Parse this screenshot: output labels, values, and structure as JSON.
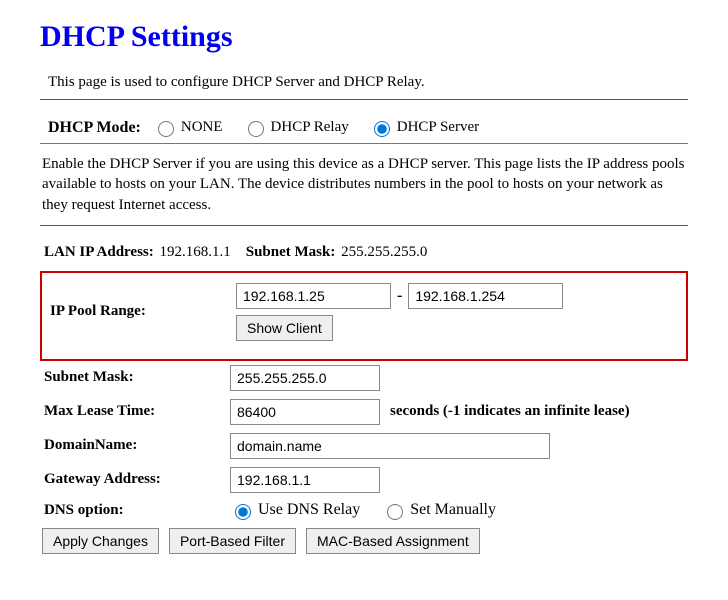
{
  "title": "DHCP Settings",
  "intro": "This page is used to configure DHCP Server and DHCP Relay.",
  "mode": {
    "label": "DHCP Mode:",
    "options": {
      "none": "NONE",
      "relay": "DHCP Relay",
      "server": "DHCP Server"
    },
    "selected": "server"
  },
  "description": "Enable the DHCP Server if you are using this device as a DHCP server. This page lists the IP address pools available to hosts on your LAN. The device distributes numbers in the pool to hosts on your network as they request Internet access.",
  "lan": {
    "ip_label": "LAN IP Address:",
    "ip_value": "192.168.1.1",
    "mask_label": "Subnet Mask:",
    "mask_value": "255.255.255.0"
  },
  "pool": {
    "label": "IP Pool Range:",
    "start": "192.168.1.25",
    "end": "192.168.1.254",
    "show_client": "Show Client"
  },
  "subnet": {
    "label": "Subnet Mask:",
    "value": "255.255.255.0"
  },
  "lease": {
    "label": "Max Lease Time:",
    "value": "86400",
    "suffix": "seconds (-1 indicates an infinite lease)"
  },
  "domain": {
    "label": "DomainName:",
    "value": "domain.name"
  },
  "gateway": {
    "label": "Gateway Address:",
    "value": "192.168.1.1"
  },
  "dns": {
    "label": "DNS option:",
    "relay": "Use DNS Relay",
    "manual": "Set Manually",
    "selected": "relay"
  },
  "buttons": {
    "apply": "Apply Changes",
    "port_filter": "Port-Based Filter",
    "mac_assign": "MAC-Based Assignment"
  }
}
